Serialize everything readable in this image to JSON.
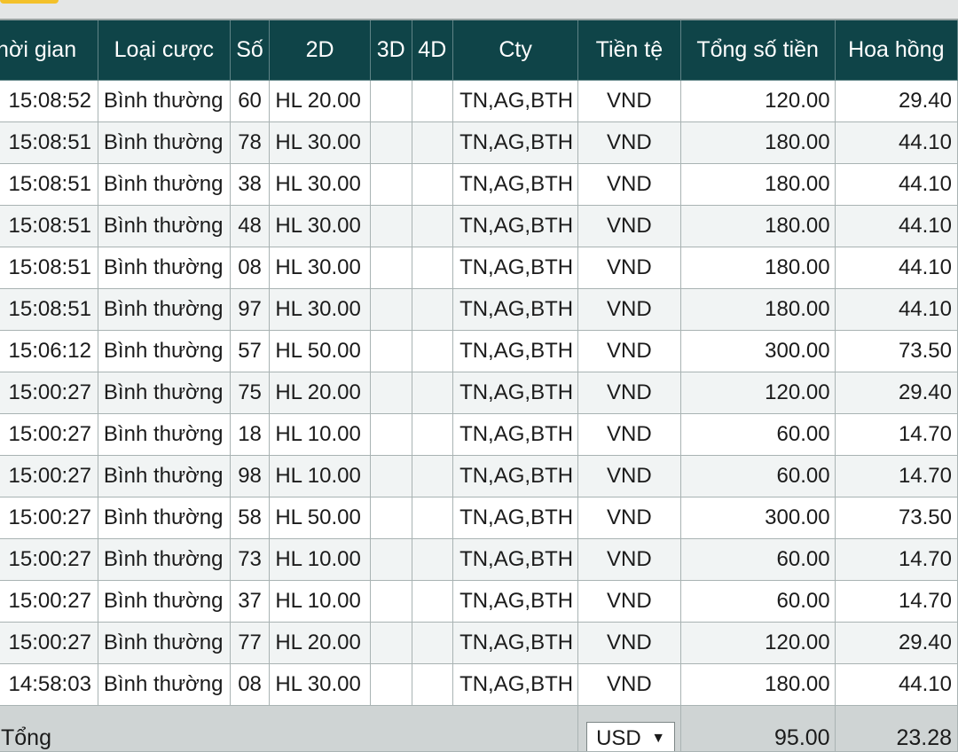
{
  "header": {
    "columns": [
      "Thời gian",
      "Loại cược",
      "Số",
      "2D",
      "3D",
      "4D",
      "Cty",
      "Tiền tệ",
      "Tổng số tiền",
      "Hoa hồng"
    ]
  },
  "rows": [
    {
      "time": "15:08:52",
      "type": "Bình thường",
      "number": "60",
      "d2": "HL 20.00",
      "d3": "",
      "d4": "",
      "cty": "TN,AG,BTH",
      "currency": "VND",
      "total": "120.00",
      "commission": "29.40"
    },
    {
      "time": "15:08:51",
      "type": "Bình thường",
      "number": "78",
      "d2": "HL 30.00",
      "d3": "",
      "d4": "",
      "cty": "TN,AG,BTH",
      "currency": "VND",
      "total": "180.00",
      "commission": "44.10"
    },
    {
      "time": "15:08:51",
      "type": "Bình thường",
      "number": "38",
      "d2": "HL 30.00",
      "d3": "",
      "d4": "",
      "cty": "TN,AG,BTH",
      "currency": "VND",
      "total": "180.00",
      "commission": "44.10"
    },
    {
      "time": "15:08:51",
      "type": "Bình thường",
      "number": "48",
      "d2": "HL 30.00",
      "d3": "",
      "d4": "",
      "cty": "TN,AG,BTH",
      "currency": "VND",
      "total": "180.00",
      "commission": "44.10"
    },
    {
      "time": "15:08:51",
      "type": "Bình thường",
      "number": "08",
      "d2": "HL 30.00",
      "d3": "",
      "d4": "",
      "cty": "TN,AG,BTH",
      "currency": "VND",
      "total": "180.00",
      "commission": "44.10"
    },
    {
      "time": "15:08:51",
      "type": "Bình thường",
      "number": "97",
      "d2": "HL 30.00",
      "d3": "",
      "d4": "",
      "cty": "TN,AG,BTH",
      "currency": "VND",
      "total": "180.00",
      "commission": "44.10"
    },
    {
      "time": "15:06:12",
      "type": "Bình thường",
      "number": "57",
      "d2": "HL 50.00",
      "d3": "",
      "d4": "",
      "cty": "TN,AG,BTH",
      "currency": "VND",
      "total": "300.00",
      "commission": "73.50"
    },
    {
      "time": "15:00:27",
      "type": "Bình thường",
      "number": "75",
      "d2": "HL 20.00",
      "d3": "",
      "d4": "",
      "cty": "TN,AG,BTH",
      "currency": "VND",
      "total": "120.00",
      "commission": "29.40"
    },
    {
      "time": "15:00:27",
      "type": "Bình thường",
      "number": "18",
      "d2": "HL 10.00",
      "d3": "",
      "d4": "",
      "cty": "TN,AG,BTH",
      "currency": "VND",
      "total": "60.00",
      "commission": "14.70"
    },
    {
      "time": "15:00:27",
      "type": "Bình thường",
      "number": "98",
      "d2": "HL 10.00",
      "d3": "",
      "d4": "",
      "cty": "TN,AG,BTH",
      "currency": "VND",
      "total": "60.00",
      "commission": "14.70"
    },
    {
      "time": "15:00:27",
      "type": "Bình thường",
      "number": "58",
      "d2": "HL 50.00",
      "d3": "",
      "d4": "",
      "cty": "TN,AG,BTH",
      "currency": "VND",
      "total": "300.00",
      "commission": "73.50"
    },
    {
      "time": "15:00:27",
      "type": "Bình thường",
      "number": "73",
      "d2": "HL 10.00",
      "d3": "",
      "d4": "",
      "cty": "TN,AG,BTH",
      "currency": "VND",
      "total": "60.00",
      "commission": "14.70"
    },
    {
      "time": "15:00:27",
      "type": "Bình thường",
      "number": "37",
      "d2": "HL 10.00",
      "d3": "",
      "d4": "",
      "cty": "TN,AG,BTH",
      "currency": "VND",
      "total": "60.00",
      "commission": "14.70"
    },
    {
      "time": "15:00:27",
      "type": "Bình thường",
      "number": "77",
      "d2": "HL 20.00",
      "d3": "",
      "d4": "",
      "cty": "TN,AG,BTH",
      "currency": "VND",
      "total": "120.00",
      "commission": "29.40"
    },
    {
      "time": "14:58:03",
      "type": "Bình thường",
      "number": "08",
      "d2": "HL 30.00",
      "d3": "",
      "d4": "",
      "cty": "TN,AG,BTH",
      "currency": "VND",
      "total": "180.00",
      "commission": "44.10"
    }
  ],
  "footer": {
    "label": "Tổng",
    "currency_selected": "USD",
    "caret": "▼",
    "total": "95.00",
    "commission": "23.28"
  },
  "colors": {
    "header_bg": "#0f4448",
    "footer_bg": "#cfd4d4",
    "accent_tab": "#f3c12a"
  }
}
